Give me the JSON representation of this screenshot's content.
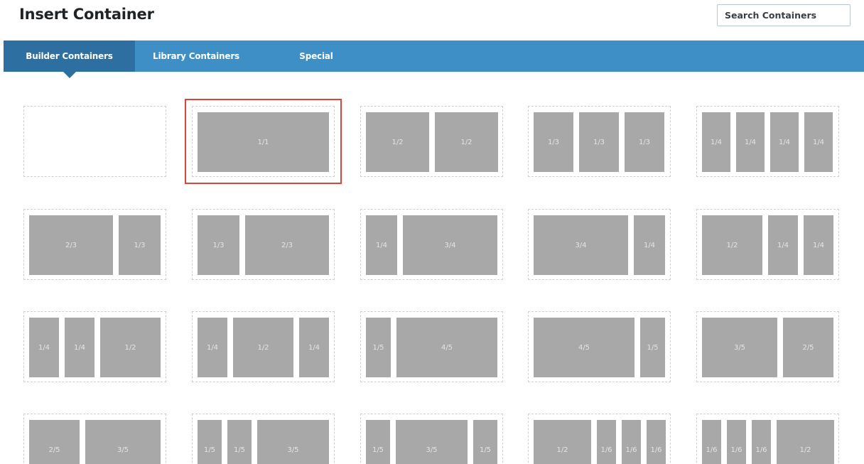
{
  "header": {
    "title": "Insert Container",
    "search_placeholder": "Search Containers"
  },
  "tabs": [
    {
      "label": "Builder Containers",
      "active": true
    },
    {
      "label": "Library Containers",
      "active": false
    },
    {
      "label": "Special",
      "active": false
    }
  ],
  "colors": {
    "tab_bar": "#3d8fc5",
    "tab_active": "#2e6fa1",
    "column_fill": "#a8a8a8",
    "selection_outline": "#d84637"
  },
  "selected_layout": "1/1",
  "layouts": [
    [],
    [
      "1/1"
    ],
    [
      "1/2",
      "1/2"
    ],
    [
      "1/3",
      "1/3",
      "1/3"
    ],
    [
      "1/4",
      "1/4",
      "1/4",
      "1/4"
    ],
    [
      "2/3",
      "1/3"
    ],
    [
      "1/3",
      "2/3"
    ],
    [
      "1/4",
      "3/4"
    ],
    [
      "3/4",
      "1/4"
    ],
    [
      "1/2",
      "1/4",
      "1/4"
    ],
    [
      "1/4",
      "1/4",
      "1/2"
    ],
    [
      "1/4",
      "1/2",
      "1/4"
    ],
    [
      "1/5",
      "4/5"
    ],
    [
      "4/5",
      "1/5"
    ],
    [
      "3/5",
      "2/5"
    ],
    [
      "2/5",
      "3/5"
    ],
    [
      "1/5",
      "1/5",
      "3/5"
    ],
    [
      "1/5",
      "3/5",
      "1/5"
    ],
    [
      "1/2",
      "1/6",
      "1/6",
      "1/6"
    ],
    [
      "1/6",
      "1/6",
      "1/6",
      "1/2"
    ]
  ]
}
